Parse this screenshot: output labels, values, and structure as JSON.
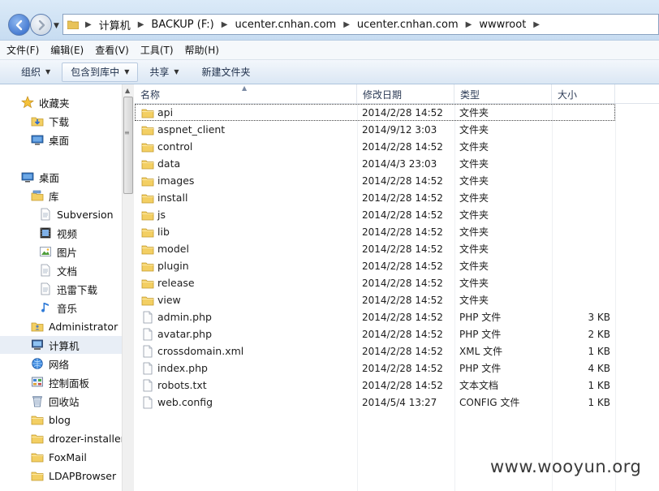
{
  "address": {
    "crumbs": [
      "计算机",
      "BACKUP (F:)",
      "ucenter.cnhan.com",
      "ucenter.cnhan.com",
      "wwwroot"
    ]
  },
  "menu": [
    "文件(F)",
    "编辑(E)",
    "查看(V)",
    "工具(T)",
    "帮助(H)"
  ],
  "toolbar": {
    "organize": "组织",
    "include_library": "包含到库中",
    "share": "共享",
    "new_folder": "新建文件夹"
  },
  "sidebar": [
    {
      "label": "收藏夹",
      "icon": "star-icon"
    },
    {
      "label": "下载",
      "icon": "download-folder-icon"
    },
    {
      "label": "桌面",
      "icon": "desktop-icon"
    },
    {
      "label": "桌面",
      "icon": "desktop-icon"
    },
    {
      "label": "库",
      "icon": "library-icon"
    },
    {
      "label": "Subversion",
      "icon": "document-icon"
    },
    {
      "label": "视频",
      "icon": "video-icon"
    },
    {
      "label": "图片",
      "icon": "picture-icon"
    },
    {
      "label": "文档",
      "icon": "document-icon"
    },
    {
      "label": "迅雷下载",
      "icon": "document-icon"
    },
    {
      "label": "音乐",
      "icon": "music-icon"
    },
    {
      "label": "Administrator",
      "icon": "user-folder-icon"
    },
    {
      "label": "计算机",
      "icon": "computer-icon"
    },
    {
      "label": "网络",
      "icon": "network-icon"
    },
    {
      "label": "控制面板",
      "icon": "control-panel-icon"
    },
    {
      "label": "回收站",
      "icon": "recycle-bin-icon"
    },
    {
      "label": "blog",
      "icon": "folder-icon"
    },
    {
      "label": "drozer-installer",
      "icon": "folder-icon"
    },
    {
      "label": "FoxMail",
      "icon": "folder-icon"
    },
    {
      "label": "LDAPBrowser",
      "icon": "folder-icon"
    }
  ],
  "columns": {
    "name": "名称",
    "date": "修改日期",
    "type": "类型",
    "size": "大小"
  },
  "files": [
    {
      "name": "api",
      "date": "2014/2/28 14:52",
      "type": "文件夹",
      "size": "",
      "kind": "folder"
    },
    {
      "name": "aspnet_client",
      "date": "2014/9/12 3:03",
      "type": "文件夹",
      "size": "",
      "kind": "folder"
    },
    {
      "name": "control",
      "date": "2014/2/28 14:52",
      "type": "文件夹",
      "size": "",
      "kind": "folder"
    },
    {
      "name": "data",
      "date": "2014/4/3 23:03",
      "type": "文件夹",
      "size": "",
      "kind": "folder"
    },
    {
      "name": "images",
      "date": "2014/2/28 14:52",
      "type": "文件夹",
      "size": "",
      "kind": "folder"
    },
    {
      "name": "install",
      "date": "2014/2/28 14:52",
      "type": "文件夹",
      "size": "",
      "kind": "folder"
    },
    {
      "name": "js",
      "date": "2014/2/28 14:52",
      "type": "文件夹",
      "size": "",
      "kind": "folder"
    },
    {
      "name": "lib",
      "date": "2014/2/28 14:52",
      "type": "文件夹",
      "size": "",
      "kind": "folder"
    },
    {
      "name": "model",
      "date": "2014/2/28 14:52",
      "type": "文件夹",
      "size": "",
      "kind": "folder"
    },
    {
      "name": "plugin",
      "date": "2014/2/28 14:52",
      "type": "文件夹",
      "size": "",
      "kind": "folder"
    },
    {
      "name": "release",
      "date": "2014/2/28 14:52",
      "type": "文件夹",
      "size": "",
      "kind": "folder"
    },
    {
      "name": "view",
      "date": "2014/2/28 14:52",
      "type": "文件夹",
      "size": "",
      "kind": "folder"
    },
    {
      "name": "admin.php",
      "date": "2014/2/28 14:52",
      "type": "PHP 文件",
      "size": "3 KB",
      "kind": "file"
    },
    {
      "name": "avatar.php",
      "date": "2014/2/28 14:52",
      "type": "PHP 文件",
      "size": "2 KB",
      "kind": "file"
    },
    {
      "name": "crossdomain.xml",
      "date": "2014/2/28 14:52",
      "type": "XML 文件",
      "size": "1 KB",
      "kind": "file"
    },
    {
      "name": "index.php",
      "date": "2014/2/28 14:52",
      "type": "PHP 文件",
      "size": "4 KB",
      "kind": "file"
    },
    {
      "name": "robots.txt",
      "date": "2014/2/28 14:52",
      "type": "文本文档",
      "size": "1 KB",
      "kind": "file"
    },
    {
      "name": "web.config",
      "date": "2014/5/4 13:27",
      "type": "CONFIG 文件",
      "size": "1 KB",
      "kind": "file"
    }
  ],
  "watermark": "www.wooyun.org"
}
